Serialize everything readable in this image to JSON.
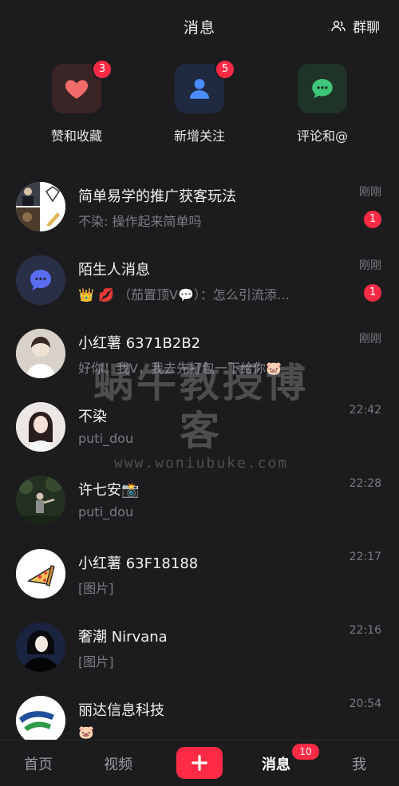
{
  "header": {
    "title": "消息",
    "group_chat_label": "群聊"
  },
  "quick_actions": [
    {
      "label": "赞和收藏",
      "icon": "heart-icon",
      "badge": "3",
      "color": "#f26b6b",
      "bg": "#3a2426"
    },
    {
      "label": "新增关注",
      "icon": "person-icon",
      "badge": "5",
      "color": "#4a8cff",
      "bg": "#1f2940"
    },
    {
      "label": "评论和@",
      "icon": "chat-bubble-icon",
      "badge": "",
      "color": "#3ec77a",
      "bg": "#1f3328"
    }
  ],
  "conversations": [
    {
      "name": "简单易学的推广获客玩法",
      "preview": "不染: 操作起来简单吗",
      "time": "刚刚",
      "unread": "1",
      "avatar": "group-collage-avatar"
    },
    {
      "name": "陌生人消息",
      "preview": "👑 💋 （茄置顶V💬）：怎么引流添…",
      "time": "刚刚",
      "unread": "1",
      "avatar": "stranger-avatar"
    },
    {
      "name": "小红薯 6371B2B2",
      "preview": "好你！我V，我去先打包一下给你🐷",
      "time": "刚刚",
      "unread": "",
      "avatar": "user-avatar"
    },
    {
      "name": "不染",
      "preview": "puti_dou",
      "time": "22:42",
      "unread": "",
      "avatar": "user-avatar"
    },
    {
      "name": "许七安📸",
      "preview": "puti_dou",
      "time": "22:28",
      "unread": "",
      "avatar": "user-avatar"
    },
    {
      "name": "小红薯 63F18188",
      "preview": "[图片]",
      "time": "22:17",
      "unread": "",
      "avatar": "pizza-avatar"
    },
    {
      "name": "奢潮 Nirvana",
      "preview": "[图片]",
      "time": "22:16",
      "unread": "",
      "avatar": "user-avatar"
    },
    {
      "name": "丽达信息科技",
      "preview": "🐷",
      "time": "20:54",
      "unread": "",
      "avatar": "logo-avatar"
    }
  ],
  "bottom_nav": {
    "home": "首页",
    "video": "视频",
    "messages": "消息",
    "messages_badge": "10",
    "me": "我"
  },
  "watermark": {
    "main": "蜗牛教授博客",
    "sub": "www.woniubuke.com"
  },
  "colors": {
    "accent": "#ff2b46",
    "background": "#1c1c1e"
  }
}
